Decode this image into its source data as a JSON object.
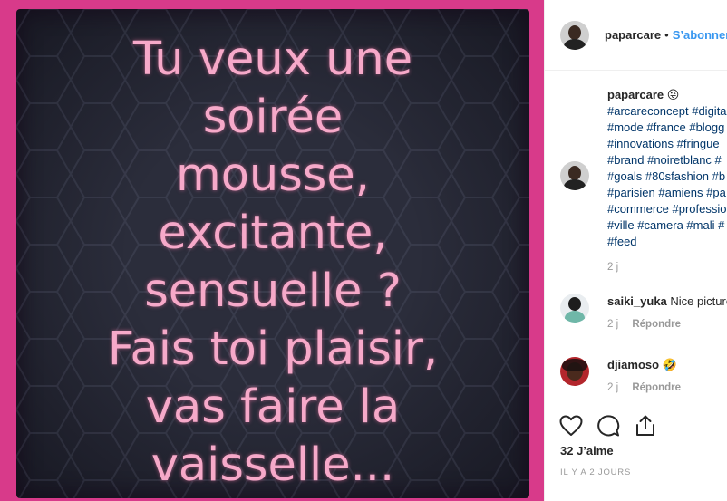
{
  "post": {
    "lines": [
      "Tu veux une",
      "soirée",
      "mousse,",
      "excitante,",
      "sensuelle ?",
      "Fais toi plaisir,",
      "vas faire la",
      "vaisselle..."
    ],
    "colors": {
      "border": "#d83a8a",
      "panel": "#2b2d3b",
      "text": "#f6a9c9"
    }
  },
  "header": {
    "username": "paparcare",
    "separator": "•",
    "follow_label": "S’abonner"
  },
  "caption": {
    "username": "paparcare",
    "emoji": "😜",
    "hashtag_lines": [
      "#arcareconcept #digita",
      "#mode #france #blogg",
      "#innovations #fringue",
      "#brand #noiretblanc #",
      "#goals #80sfashion #b",
      "#parisien #amiens #pa",
      "#commerce #professio",
      "#ville #camera #mali #",
      "#feed"
    ],
    "time": "2 j"
  },
  "comments": [
    {
      "username": "saiki_yuka",
      "text": "Nice picture",
      "time": "2 j",
      "reply_label": "Répondre"
    },
    {
      "username": "djiamoso",
      "text": "🤣",
      "time": "2 j",
      "reply_label": "Répondre"
    }
  ],
  "footer": {
    "icons": [
      "heart-icon",
      "comment-icon",
      "share-icon"
    ],
    "likes": "32 J’aime",
    "posted": "IL Y A 2 JOURS"
  }
}
